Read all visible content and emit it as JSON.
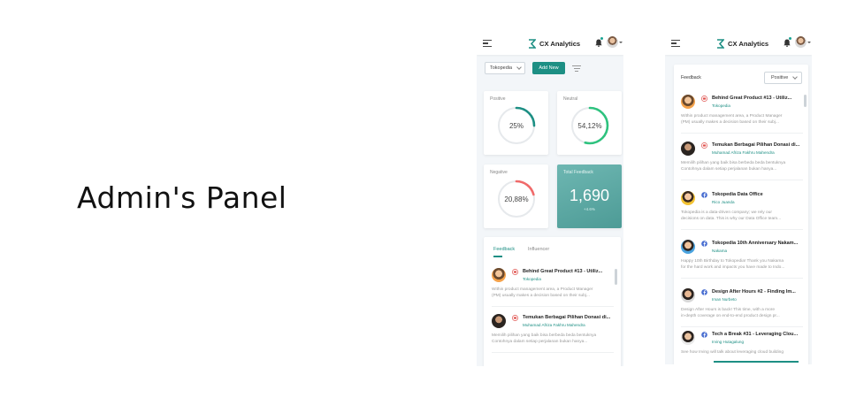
{
  "headline": "Admin's Panel",
  "brand": "CX Analytics",
  "colors": {
    "accent": "#1d8f84",
    "positive": "#1d8f84",
    "neutral": "#2ec27e",
    "negative": "#f06a6a",
    "ring": "#e6e9ec",
    "youtube": "#e0534f",
    "facebook": "#4a6fd1"
  },
  "screen1": {
    "store_select": "Tokopedia",
    "add_button": "Add New",
    "stats": [
      {
        "title": "Positive",
        "value": "25%",
        "percent": 25,
        "color": "#1d8f84"
      },
      {
        "title": "Neutral",
        "value": "54,12%",
        "percent": 54.12,
        "color": "#2ec27e"
      },
      {
        "title": "Negative",
        "value": "20,88%",
        "percent": 20.88,
        "color": "#f06a6a"
      }
    ],
    "total": {
      "title": "Total Feedback",
      "value": "1,690",
      "sub": "+4.6%"
    },
    "tabs": [
      "Feedback",
      "Influencer"
    ],
    "items": [
      {
        "title": "Behind Great Product #13 - Utiliz...",
        "author": "Tokopedia",
        "body1": "Within product management area, a Product Manager",
        "body2": "(PM) usually makes a decision based on their subj...",
        "source": "youtube-icon"
      },
      {
        "title": "Temukan Berbagai Pilihan Donasi di...",
        "author": "Muhamad Afriza Fakhru Mahendra",
        "body1": "Memilih pilihan yang baik bisa berbeda beda bentuknya",
        "body2": "Contohnya dalam setiap perjalanan bukan hanya...",
        "source": "youtube-icon"
      }
    ]
  },
  "screen2": {
    "title": "Feedback",
    "filter_select": "Positive",
    "items": [
      {
        "title": "Behind Great Product #13 - Utiliz...",
        "author": "Tokopedia",
        "body1": "Within product management area, a Product Manager",
        "body2": "(PM) usually makes a decision based on their subj...",
        "source": "youtube-icon"
      },
      {
        "title": "Temukan Berbagai Pilihan Donasi di...",
        "author": "Muhamad Afriza Fakhru Mahendra",
        "body1": "Memilih pilihan yang baik bisa berbeda beda bentuknya",
        "body2": "Contohnya dalam setiap perjalanan bukan hanya...",
        "source": "youtube-icon"
      },
      {
        "title": "Tokopedia Data Office",
        "author": "Rico Juanda",
        "body1": "Tokopedia is a data-driven company; we rely our",
        "body2": "decisions on data. This is why our Data Office team...",
        "source": "facebook-icon"
      },
      {
        "title": "Tokopedia 10th Anniversary Nakam...",
        "author": "Nakama",
        "body1": "Happy 10th Birthday to Tokopedia! Thank you Nakama",
        "body2": "for the hard work and impacts you have made to Indo...",
        "source": "facebook-icon"
      },
      {
        "title": "Design After Hours #2 - Finding Im...",
        "author": "Iman Nurbeto",
        "body1": "Design After Hours is back! This time, with a more",
        "body2": "in-depth coverage on end-to-end product design pr...",
        "source": "facebook-icon"
      },
      {
        "title": "Tech a Break #31 - Leveraging Clou...",
        "author": "Irving Hutagalung",
        "body1": "See how Irving will talk about leveraging cloud building",
        "body2": "",
        "source": "facebook-icon"
      }
    ]
  }
}
